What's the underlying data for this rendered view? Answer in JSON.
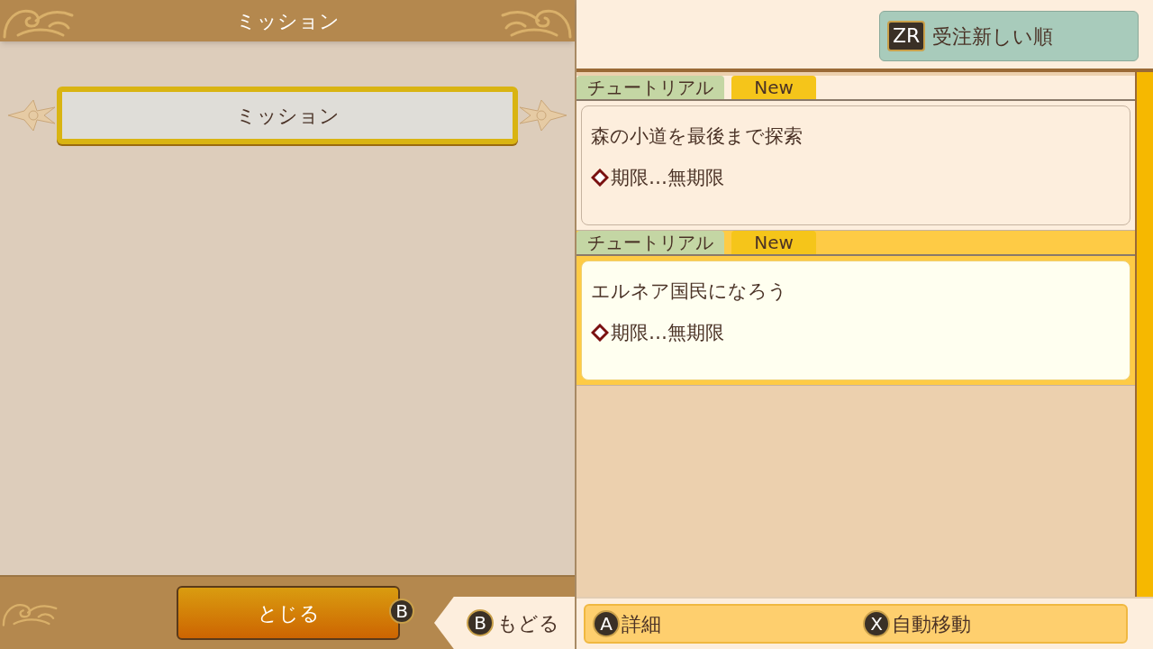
{
  "left_panel": {
    "title": "ミッション",
    "categories": [
      {
        "label": "ミッション",
        "selected": true
      }
    ],
    "close_button": {
      "label": "とじる",
      "key": "B"
    }
  },
  "sort_button": {
    "key": "ZR",
    "label": "受注新しい順"
  },
  "missions": [
    {
      "tag": "チュートリアル",
      "badge": "New",
      "title": "森の小道を最後まで探索",
      "deadline": "期限…無期限",
      "selected": false
    },
    {
      "tag": "チュートリアル",
      "badge": "New",
      "title": "エルネア国民になろう",
      "deadline": "期限…無期限",
      "selected": true
    }
  ],
  "footer": {
    "back": {
      "key": "B",
      "label": "もどる"
    },
    "actions": [
      {
        "key": "A",
        "label": "詳細"
      },
      {
        "key": "X",
        "label": "自動移動"
      }
    ]
  }
}
